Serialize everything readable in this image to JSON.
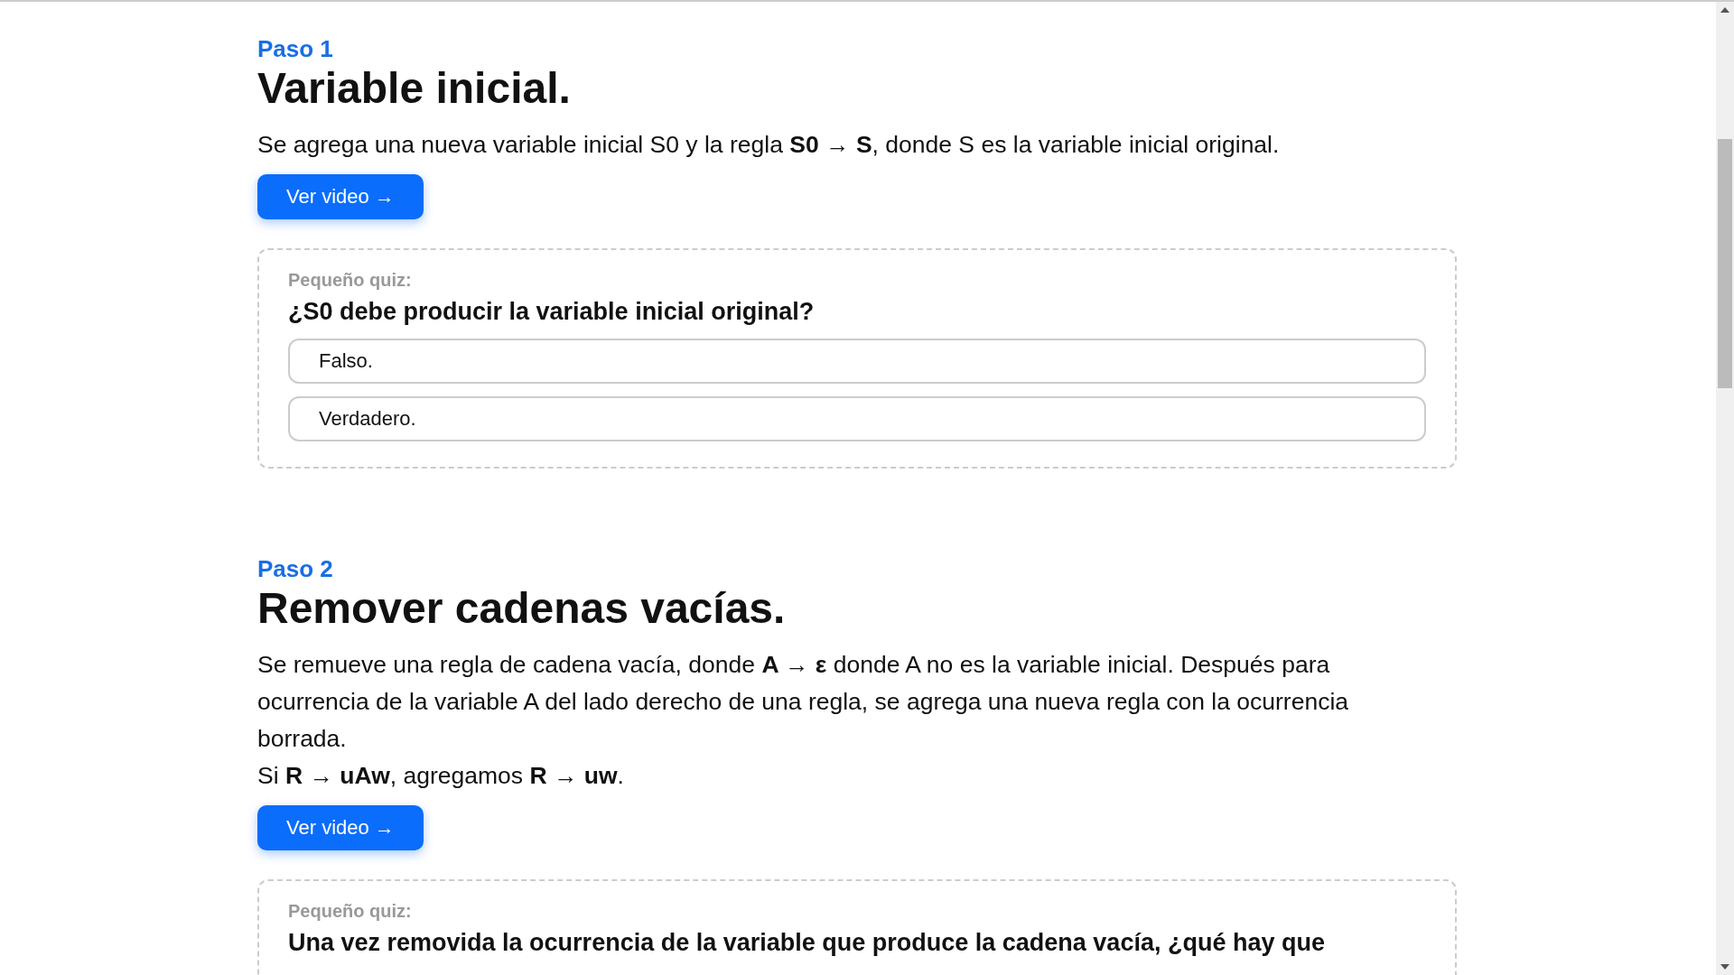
{
  "steps": [
    {
      "step_label": "Paso 1",
      "title": "Variable inicial.",
      "paragraphs": [
        "Se agrega una nueva variable inicial S0 y la regla **S0 → S**, donde S es la variable inicial original."
      ],
      "button": "Ver video →",
      "quiz": {
        "label": "Pequeño quiz:",
        "question": "¿S0 debe producir la variable inicial original?",
        "options": [
          "Falso.",
          "Verdadero."
        ]
      }
    },
    {
      "step_label": "Paso 2",
      "title": "Remover cadenas vacías.",
      "paragraphs": [
        "Se remueve una regla de cadena vacía, donde **A → ε** donde A no es la variable inicial. Después para ocurrencia de la variable A del lado derecho de una regla, se agrega una nueva regla con la ocurrencia borrada.",
        "Si **R → uAw**, agregamos **R → uw**."
      ],
      "button": "Ver video →",
      "quiz": {
        "label": "Pequeño quiz:",
        "question": "Una vez removida la ocurrencia de la variable que produce la cadena vacía, ¿qué hay que"
      }
    }
  ]
}
